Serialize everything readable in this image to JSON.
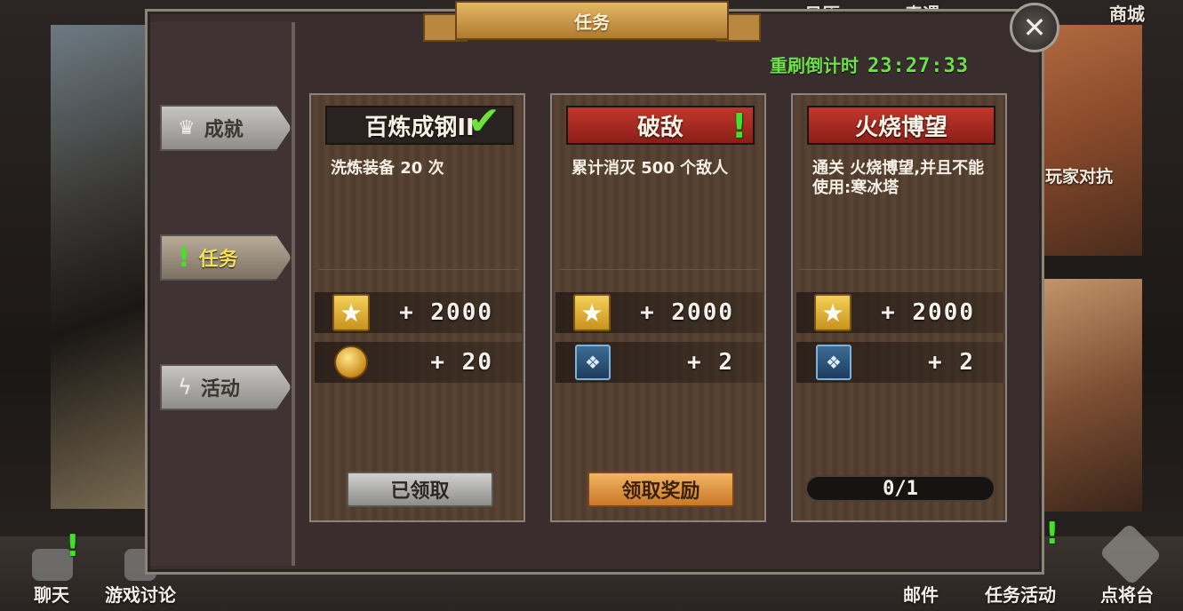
{
  "background": {
    "top_labels": [
      "日历",
      "奇遇",
      "商城"
    ],
    "right_label": "玩家对抗"
  },
  "bottom_nav": {
    "chat": "聊天",
    "discussion": "游戏讨论",
    "mail": "邮件",
    "quest_activity": "任务活动",
    "general_stage": "点将台"
  },
  "dialog": {
    "title": "任务",
    "refresh_label": "重刷倒计时",
    "countdown": "23:27:33",
    "close_glyph": "✕"
  },
  "sidebar": {
    "items": [
      {
        "label": "成就",
        "icon": "crown-icon",
        "active": false
      },
      {
        "label": "任务",
        "icon": "quest-icon",
        "active": true
      },
      {
        "label": "活动",
        "icon": "lightning-icon",
        "active": false
      }
    ]
  },
  "cards": [
    {
      "title": "百炼成钢II",
      "description": "洗炼装备 20 次",
      "reward1_value": "+ 2000",
      "reward1_icon": "star-icon",
      "reward2_value": "+ 20",
      "reward2_icon": "gold-coins-icon",
      "action_label": "已领取",
      "status": "claimed"
    },
    {
      "title": "破敌",
      "description": "累计消灭 500 个敌人",
      "reward1_value": "+ 2000",
      "reward1_icon": "star-icon",
      "reward2_value": "+ 2",
      "reward2_icon": "card-pack-icon",
      "action_label": "领取奖励",
      "status": "claimable"
    },
    {
      "title": "火烧博望",
      "description": "通关 火烧博望,并且不能使用:寒冰塔",
      "reward1_value": "+ 2000",
      "reward1_icon": "star-icon",
      "reward2_value": "+ 2",
      "reward2_icon": "card-pack-icon",
      "progress": "0/1",
      "status": "in-progress"
    }
  ],
  "colors": {
    "accent_green": "#6ee04a",
    "title_red": "#c0372c",
    "gold": "#e3b865"
  }
}
